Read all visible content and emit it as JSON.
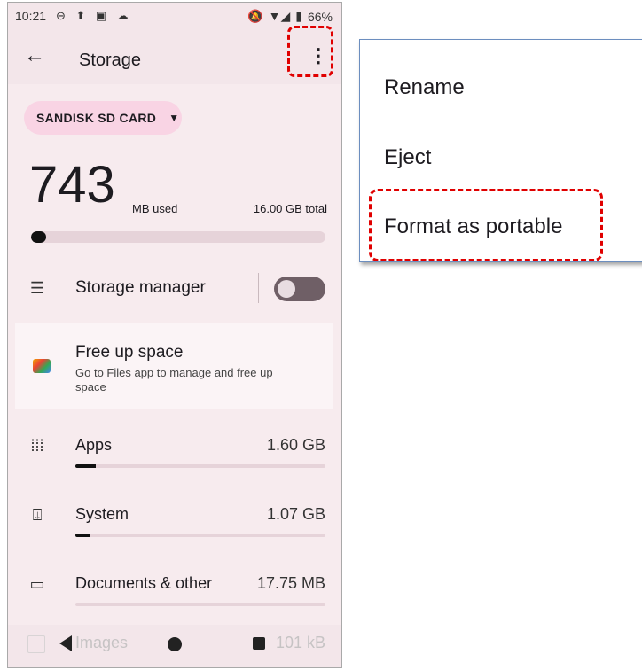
{
  "status_bar": {
    "time": "10:21",
    "battery": "66%"
  },
  "app_bar": {
    "title": "Storage"
  },
  "storage": {
    "device_chip": "SANDISK SD CARD",
    "used_value": "743",
    "used_unit": "MB used",
    "total": "16.00 GB total",
    "used_fraction": 0.05
  },
  "storage_manager": {
    "label": "Storage manager",
    "enabled": false
  },
  "free_up": {
    "title": "Free up space",
    "subtitle": "Go to Files app to manage and free up space"
  },
  "categories": [
    {
      "label": "Apps",
      "size": "1.60 GB",
      "fraction": 0.08
    },
    {
      "label": "System",
      "size": "1.07 GB",
      "fraction": 0.06
    },
    {
      "label": "Documents & other",
      "size": "17.75 MB",
      "fraction": 0.0
    }
  ],
  "peek_row": {
    "label": "Images",
    "size": "101 kB"
  },
  "overflow_menu": {
    "items": [
      "Rename",
      "Eject",
      "Format as portable"
    ]
  },
  "colors": {
    "highlight": "#e00000",
    "background": "#f7ebee",
    "chip": "#f9d4e4"
  }
}
